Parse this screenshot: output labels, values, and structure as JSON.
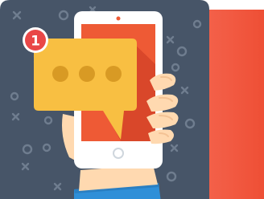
{
  "colors": {
    "card_background": "#475568",
    "back_card": "#f25a42",
    "pattern": "#6f7d8f",
    "phone_body": "#ffffff",
    "phone_screen": "#ee5a35",
    "message_bubble": "#f8bf42",
    "bubble_dots": "#d89a24",
    "badge": "#e94747",
    "skin": "#ffd9b0",
    "sleeve": "#2f8fd8"
  },
  "notification": {
    "count": "1"
  },
  "icons": {
    "badge": "notification-badge-icon",
    "chat": "chat-bubble-icon",
    "phone": "smartphone-icon",
    "hand": "hand-icon"
  }
}
